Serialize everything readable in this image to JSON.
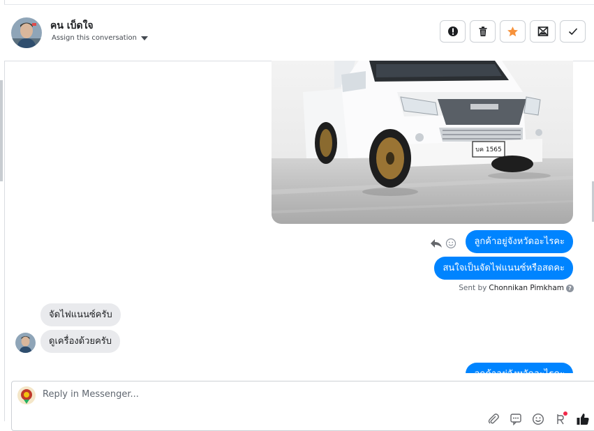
{
  "header": {
    "contact_name": "คน เบ็ดใจ",
    "assign_label": "Assign this conversation",
    "actions": [
      {
        "name": "spam-button",
        "icon": "exclamation-circle-icon"
      },
      {
        "name": "delete-button",
        "icon": "trash-icon"
      },
      {
        "name": "star-button",
        "icon": "star-icon",
        "color": "#f7923b"
      },
      {
        "name": "mark-unread-button",
        "icon": "envelope-icon"
      },
      {
        "name": "done-button",
        "icon": "checkmark-icon"
      }
    ]
  },
  "messages": {
    "image": {
      "description_icon": "car-photo"
    },
    "outgoing": [
      "ลูกค้าอยู่จังหวัดอะไรคะ",
      "สนใจเป็นจัดไฟแนนซ์หรือสดคะ"
    ],
    "sent_by_prefix": "Sent by",
    "sent_by_agent": "Chonnikan Pimkham",
    "incoming": [
      "จัดไฟแนนซ์ครับ",
      "ดูเครื่องด้วยครับ"
    ],
    "outgoing_partial": "ลูกค้าอยู่จังหวัดอะไรคะ",
    "license_plate": "บค 1565"
  },
  "composer": {
    "placeholder": "Reply in Messenger...",
    "tools": [
      "paperclip-icon",
      "saved-reply-icon",
      "emoji-icon",
      "appointment-icon",
      "like-icon"
    ]
  },
  "colors": {
    "accent": "#0084ff",
    "incoming_bubble": "#e9eaed",
    "star": "#f7923b"
  }
}
